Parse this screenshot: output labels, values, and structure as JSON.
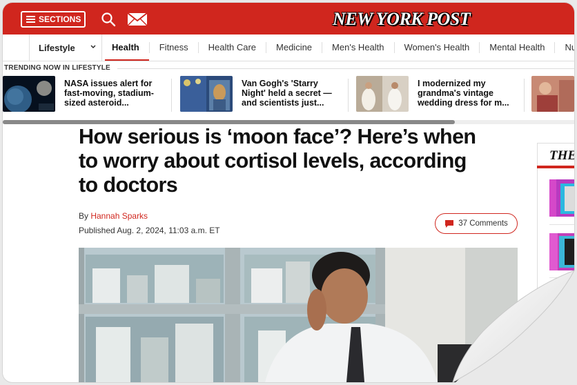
{
  "header": {
    "sections_label": "SECTIONS",
    "logo_text": "NEW YORK POST",
    "brand_color": "#d0261e",
    "icons": [
      "menu-icon",
      "search-icon",
      "mail-icon"
    ]
  },
  "nav": {
    "section_label": "Lifestyle",
    "items": [
      {
        "label": "Health",
        "active": true
      },
      {
        "label": "Fitness"
      },
      {
        "label": "Health Care"
      },
      {
        "label": "Medicine"
      },
      {
        "label": "Men's Health"
      },
      {
        "label": "Women's Health"
      },
      {
        "label": "Mental Health"
      },
      {
        "label": "Nu"
      }
    ]
  },
  "trending": {
    "label": "TRENDING NOW IN LIFESTYLE",
    "items": [
      {
        "text": "NASA issues alert for fast-moving, stadium-sized asteroid..."
      },
      {
        "text": "Van Gogh's 'Starry Night' held a secret — and scientists just..."
      },
      {
        "text": "I modernized my grandma's vintage wedding dress for m..."
      }
    ]
  },
  "article": {
    "headline": "How serious is ‘moon face’? Here’s when to worry about cortisol levels, according to doctors",
    "by_prefix": "By ",
    "author": "Hannah Sparks",
    "published": "Published Aug. 2, 2024, 11:03 a.m. ET",
    "comments_label": "37 Comments"
  },
  "sidebar": {
    "heading": "THE"
  }
}
